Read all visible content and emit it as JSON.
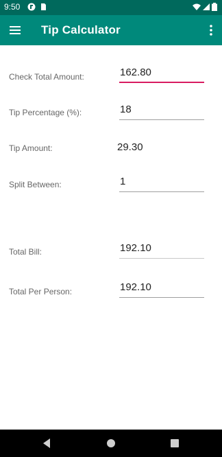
{
  "status": {
    "time": "9:50"
  },
  "app": {
    "title": "Tip Calculator"
  },
  "form": {
    "check_total_label": "Check Total Amount:",
    "check_total_value": "162.80",
    "tip_pct_label": "Tip Percentage (%):",
    "tip_pct_value": "18",
    "tip_amount_label": "Tip Amount:",
    "tip_amount_value": "29.30",
    "split_label": "Split Between:",
    "split_value": "1",
    "total_bill_label": "Total Bill:",
    "total_bill_value": "192.10",
    "per_person_label": "Total Per Person:",
    "per_person_value": "192.10"
  },
  "colors": {
    "primary": "#00897b",
    "primary_dark": "#00695c",
    "accent": "#d81b60"
  },
  "icons": [
    "menu-icon",
    "more-vert-icon",
    "wifi-icon",
    "signal-icon",
    "battery-icon",
    "back-icon",
    "home-icon",
    "recents-icon"
  ]
}
